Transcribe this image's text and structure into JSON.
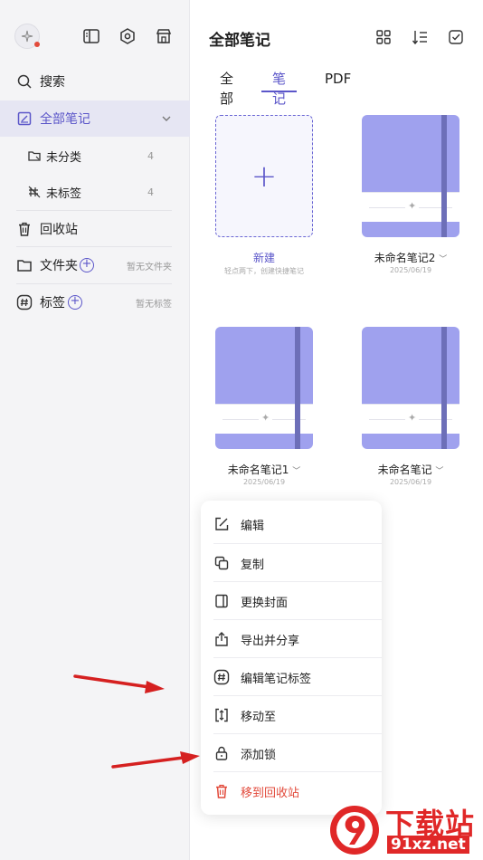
{
  "sidebar": {
    "items": [
      {
        "label": "搜索"
      },
      {
        "label": "全部笔记"
      },
      {
        "label": "未分类",
        "count": "4"
      },
      {
        "label": "未标签",
        "count": "4"
      },
      {
        "label": "回收站"
      },
      {
        "label": "文件夹",
        "hint": "暂无文件夹"
      },
      {
        "label": "标签",
        "hint": "暂无标签"
      }
    ]
  },
  "header": {
    "title": "全部笔记",
    "tabs": [
      {
        "label": "全部"
      },
      {
        "label": "笔记"
      },
      {
        "label": "PDF"
      }
    ]
  },
  "cards": [
    {
      "title": "新建",
      "subtitle": "轻点两下，创建快捷笔记"
    },
    {
      "title": "未命名笔记2",
      "date": "2025/06/19"
    },
    {
      "title": "未命名笔记1",
      "date": "2025/06/19"
    },
    {
      "title": "未命名笔记",
      "date": "2025/06/19"
    }
  ],
  "menu": {
    "items": [
      {
        "label": "编辑"
      },
      {
        "label": "复制"
      },
      {
        "label": "更换封面"
      },
      {
        "label": "导出并分享"
      },
      {
        "label": "编辑笔记标签"
      },
      {
        "label": "移动至"
      },
      {
        "label": "添加锁"
      },
      {
        "label": "移到回收站"
      }
    ]
  },
  "watermark": {
    "text": "下载站",
    "url": "91xz.net"
  },
  "colors": {
    "accent": "#5b56c9",
    "danger": "#e24a3b",
    "cover": "#9fa1ee",
    "cover_band": "#6d6fb8"
  }
}
